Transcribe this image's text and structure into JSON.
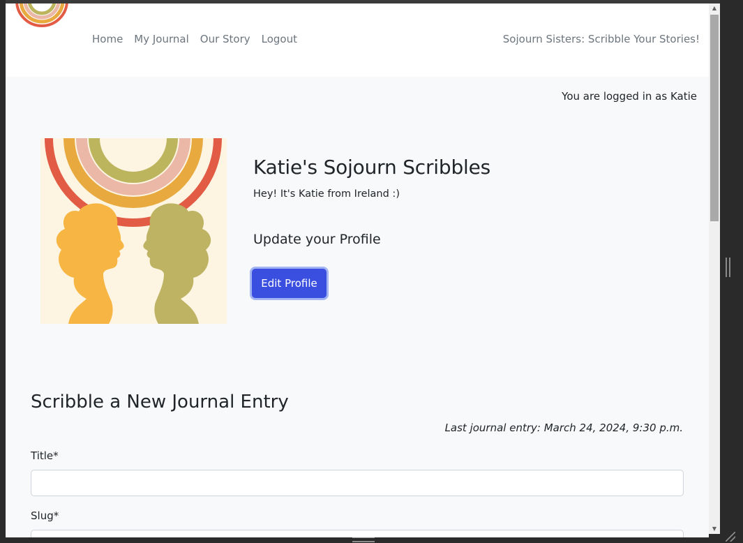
{
  "navbar": {
    "links": [
      "Home",
      "My Journal",
      "Our Story",
      "Logout"
    ],
    "tagline": "Sojourn Sisters: Scribble Your Stories!"
  },
  "session": {
    "logged_in_text": "You are logged in as Katie"
  },
  "profile": {
    "title": "Katie's Sojourn Scribbles",
    "bio": "Hey! It's Katie from Ireland :)",
    "update_heading": "Update your Profile",
    "edit_button": "Edit Profile"
  },
  "journal_form": {
    "heading": "Scribble a New Journal Entry",
    "last_entry": "Last journal entry: March 24, 2024, 9:30 p.m.",
    "fields": [
      {
        "label": "Title*",
        "value": ""
      },
      {
        "label": "Slug*",
        "value": ""
      }
    ]
  },
  "colors": {
    "rainbow_red": "#e25c45",
    "rainbow_orange": "#e8a93f",
    "rainbow_pink": "#ebb7a6",
    "rainbow_olive": "#bdb45e",
    "silhouette_left": "#f7b544",
    "silhouette_right": "#bdb363",
    "image_bg": "#fdf5e2",
    "primary_button": "#3a4fdf"
  }
}
